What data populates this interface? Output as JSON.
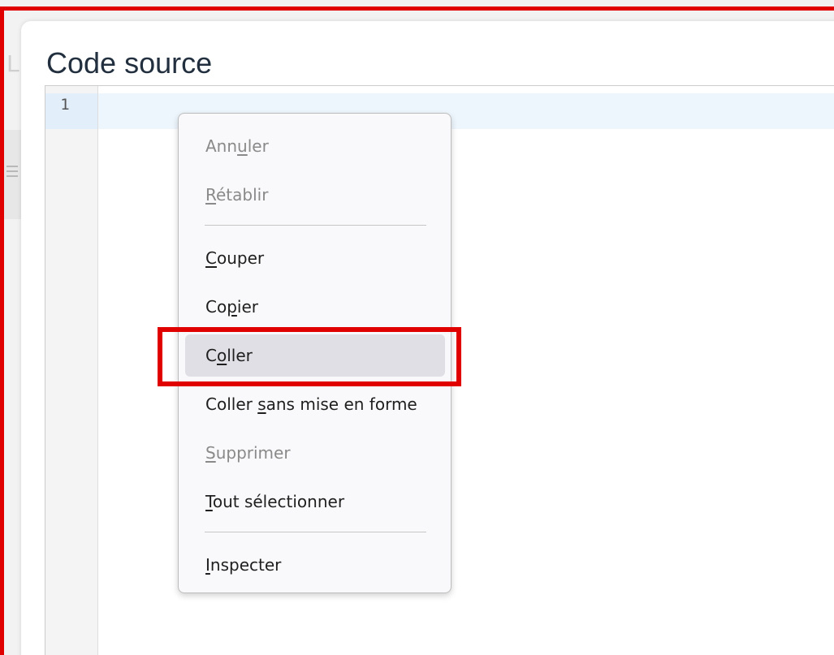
{
  "dialog": {
    "title": "Code source",
    "background_partial_letter": "L"
  },
  "editor": {
    "line_numbers": [
      "1"
    ],
    "content": ""
  },
  "context_menu": {
    "items": [
      {
        "pre": "Ann",
        "key": "u",
        "post": "ler",
        "disabled": true
      },
      {
        "pre": "",
        "key": "R",
        "post": "établir",
        "disabled": true
      },
      {
        "pre": "",
        "key": "C",
        "post": "ouper",
        "disabled": false
      },
      {
        "pre": "Co",
        "key": "p",
        "post": "ier",
        "disabled": false
      },
      {
        "pre": "C",
        "key": "o",
        "post": "ller",
        "disabled": false,
        "hover": true
      },
      {
        "pre": "Coller ",
        "key": "s",
        "post": "ans mise en forme",
        "disabled": false
      },
      {
        "pre": "",
        "key": "S",
        "post": "upprimer",
        "disabled": true
      },
      {
        "pre": "",
        "key": "T",
        "post": "out sélectionner",
        "disabled": false
      },
      {
        "pre": "",
        "key": "I",
        "post": "nspecter",
        "disabled": false
      }
    ]
  },
  "colors": {
    "annotation_red": "#e10000",
    "menu_hover": "#e0dfe5",
    "active_line": "#eef6fd"
  },
  "icons": {
    "background_menu": "hamburger-menu-icon"
  }
}
